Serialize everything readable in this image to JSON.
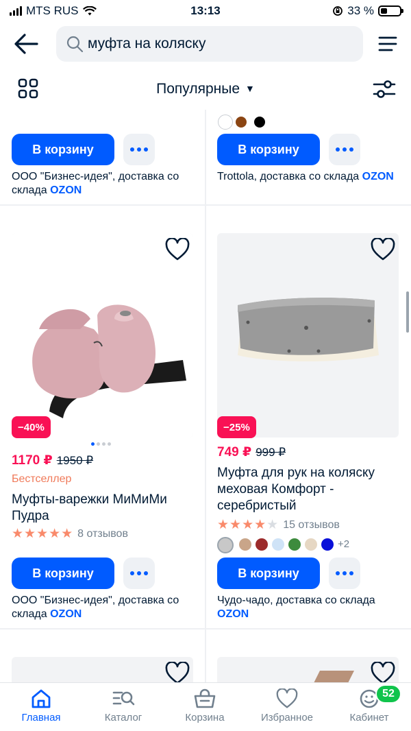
{
  "status_bar": {
    "carrier": "MTS RUS",
    "time": "13:13",
    "battery": "33 %"
  },
  "search": {
    "value": "муфта на коляску"
  },
  "toolbar": {
    "sort_label": "Популярные"
  },
  "top_row": {
    "left": {
      "cart_label": "В корзину",
      "seller": "ООО \"Бизнес-идея\", доставка со склада",
      "ozon": "OZON"
    },
    "right": {
      "cart_label": "В корзину",
      "seller": "Trottola, доставка со склада",
      "ozon": "OZON",
      "swatches": [
        "#ffffff",
        "#8b4513",
        "#000000"
      ]
    }
  },
  "products": [
    {
      "discount": "−40%",
      "price": "1170 ₽",
      "old_price": "1950 ₽",
      "tag": "Бестселлер",
      "title": "Муфты-варежки МиМиМи Пудра",
      "rating": 5,
      "reviews": "8 отзывов",
      "cart_label": "В корзину",
      "seller": "ООО \"Бизнес-идея\", доставка со склада",
      "ozon": "OZON"
    },
    {
      "discount": "−25%",
      "price": "749 ₽",
      "old_price": "999 ₽",
      "title": "Муфта для рук на коляску меховая Комфорт - серебристый",
      "rating": 4.5,
      "reviews": "15 отзывов",
      "variants": [
        "#c8c8c8",
        "#c9a589",
        "#9c2b2b",
        "#cfe3f7",
        "#3d8b3d",
        "#e6d7c3",
        "#0a10d9"
      ],
      "more_variants": "+2",
      "cart_label": "В корзину",
      "seller": "Чудо-чадо, доставка со склада",
      "ozon": "OZON"
    }
  ],
  "bottom_nav": [
    {
      "label": "Главная",
      "icon": "home-icon",
      "active": true
    },
    {
      "label": "Каталог",
      "icon": "catalog-icon"
    },
    {
      "label": "Корзина",
      "icon": "cart-icon"
    },
    {
      "label": "Избранное",
      "icon": "heart-icon"
    },
    {
      "label": "Кабинет",
      "icon": "profile-icon"
    }
  ],
  "cabinet_badge": "52",
  "colors": {
    "accent": "#005bff",
    "price": "#f91155",
    "badge_green": "#10c44c"
  }
}
